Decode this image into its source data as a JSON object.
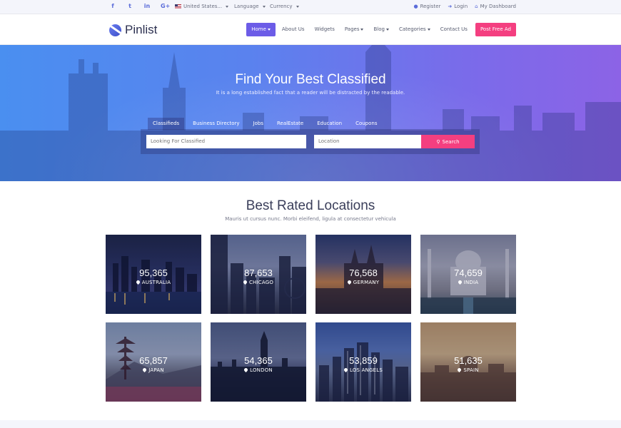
{
  "topbar": {
    "social": [
      {
        "icon": "facebook-icon",
        "glyph": "f"
      },
      {
        "icon": "twitter-icon",
        "glyph": "t"
      },
      {
        "icon": "linkedin-icon",
        "glyph": "in"
      },
      {
        "icon": "google-plus-icon",
        "glyph": "G+"
      }
    ],
    "country": "United States...",
    "language": "Language",
    "currency": "Currency",
    "register": "Register",
    "login": "Login",
    "dashboard": "My Dashboard"
  },
  "nav": {
    "logo": "Pinlist",
    "items": [
      "Home",
      "About Us",
      "Widgets",
      "Pages",
      "Blog",
      "Categories",
      "Contact Us"
    ],
    "post_ad": "Post Free Ad"
  },
  "hero": {
    "title": "Find Your Best Classified",
    "subtitle": "It is a long established fact that a reader will be distracted by the readable.",
    "tabs": [
      "Classifieds",
      "Business Directory",
      "Jobs",
      "RealEstate",
      "Education",
      "Coupons"
    ],
    "search_placeholder": "Looking For Classified",
    "location_placeholder": "Location",
    "search_button": "Search"
  },
  "locations": {
    "title": "Best Rated Locations",
    "subtitle": "Mauris ut cursus nunc. Morbi eleifend, ligula at consectetur vehicula",
    "cards": [
      {
        "count": "95,365",
        "name": "AUSTRALIA"
      },
      {
        "count": "87,653",
        "name": "CHICAGO"
      },
      {
        "count": "76,568",
        "name": "GERMANY"
      },
      {
        "count": "74,659",
        "name": "INDIA"
      },
      {
        "count": "65,857",
        "name": "JAPAN"
      },
      {
        "count": "54,365",
        "name": "LONDON"
      },
      {
        "count": "53,859",
        "name": "LOS ANGELS"
      },
      {
        "count": "51,635",
        "name": "SPAIN"
      }
    ]
  }
}
